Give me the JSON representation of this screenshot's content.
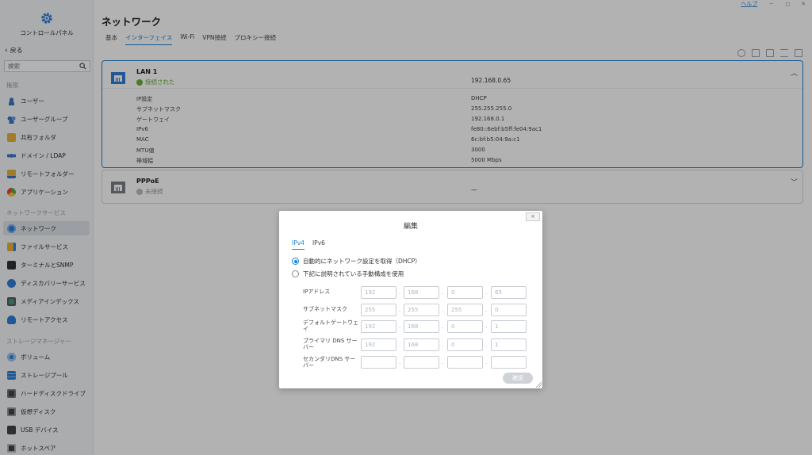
{
  "app": {
    "title": "コントロールパネル",
    "back_label": "戻る",
    "search_placeholder": "検索"
  },
  "topbar": {
    "help": "ヘルプ",
    "minimize": "－",
    "maximize": "◻",
    "close": "✕"
  },
  "sidebar": {
    "sections": [
      {
        "label": "権限"
      },
      {
        "label": "ネットワークサービス"
      },
      {
        "label": "ストレージマネージャー"
      }
    ],
    "items": [
      {
        "label": "ユーザー",
        "color": "#3a76c4"
      },
      {
        "label": "ユーザーグループ",
        "color": "#3a76c4"
      },
      {
        "label": "共有フォルダ",
        "color": "#e7b43b"
      },
      {
        "label": "ドメイン / LDAP",
        "color": "#3a76c4"
      },
      {
        "label": "リモートフォルダー",
        "color": "#e7b43b"
      },
      {
        "label": "アプリケーション",
        "color": "#4caf50"
      },
      {
        "label": "ネットワーク",
        "color": "#2f7ed8"
      },
      {
        "label": "ファイルサービス",
        "color": "#e7b43b"
      },
      {
        "label": "ターミナルとSNMP",
        "color": "#333333"
      },
      {
        "label": "ディスカバリーサービス",
        "color": "#2f7ed8"
      },
      {
        "label": "メディアインデックス",
        "color": "#3a9e6b"
      },
      {
        "label": "リモートアクセス",
        "color": "#2f7ed8"
      },
      {
        "label": "ボリューム",
        "color": "#2f7ed8"
      },
      {
        "label": "ストレージプール",
        "color": "#2f7ed8"
      },
      {
        "label": "ハードディスクドライブ",
        "color": "#444444"
      },
      {
        "label": "仮想ディスク",
        "color": "#444444"
      },
      {
        "label": "USB デバイス",
        "color": "#444444"
      },
      {
        "label": "ホットスペア",
        "color": "#444444"
      }
    ]
  },
  "main": {
    "title": "ネットワーク",
    "tabs": [
      "基本",
      "インターフェイス",
      "Wi-Fi",
      "VPN接続",
      "プロキシー接続"
    ],
    "active_tab": "インターフェイス",
    "toolbar_icons": [
      "refresh-icon",
      "edit-icon",
      "save-icon",
      "list-icon",
      "print-icon"
    ]
  },
  "lan": {
    "name": "LAN 1",
    "status": "接続された",
    "ip": "192.168.0.65",
    "details": [
      {
        "label": "IP設定",
        "value": "DHCP"
      },
      {
        "label": "サブネットマスク",
        "value": "255.255.255.0"
      },
      {
        "label": "ゲートウェイ",
        "value": "192.168.0.1"
      },
      {
        "label": "IPv6",
        "value": "fe80::6ebf:b5ff:fe04:9ac1"
      },
      {
        "label": "MAC",
        "value": "6c:bf:b5:04:9a:c1"
      },
      {
        "label": "MTU値",
        "value": "3000"
      },
      {
        "label": "帯域幅",
        "value": "5000 Mbps"
      }
    ]
  },
  "pppoe": {
    "name": "PPPoE",
    "status": "未接続",
    "ip": "—"
  },
  "dialog": {
    "title": "編集",
    "close": "×",
    "tabs": [
      "IPv4",
      "IPv6"
    ],
    "active_tab": "IPv4",
    "option_auto": "自動的にネットワーク設定を取得（DHCP）",
    "option_manual": "下記に説明されている手動構成を使用",
    "selected_option": "auto",
    "fields": [
      {
        "label": "IPアドレス",
        "octets": [
          "192",
          "168",
          "0",
          "65"
        ]
      },
      {
        "label": "サブネットマスク",
        "octets": [
          "255",
          "255",
          "255",
          "0"
        ]
      },
      {
        "label": "デフォルトゲートウェイ",
        "octets": [
          "192",
          "168",
          "0",
          "1"
        ]
      },
      {
        "label": "プライマリ DNS サーバー",
        "octets": [
          "192",
          "168",
          "0",
          "1"
        ]
      },
      {
        "label": "セカンダリDNS サーバー",
        "octets": [
          "",
          "",
          "",
          ""
        ]
      }
    ],
    "confirm": "確認"
  }
}
